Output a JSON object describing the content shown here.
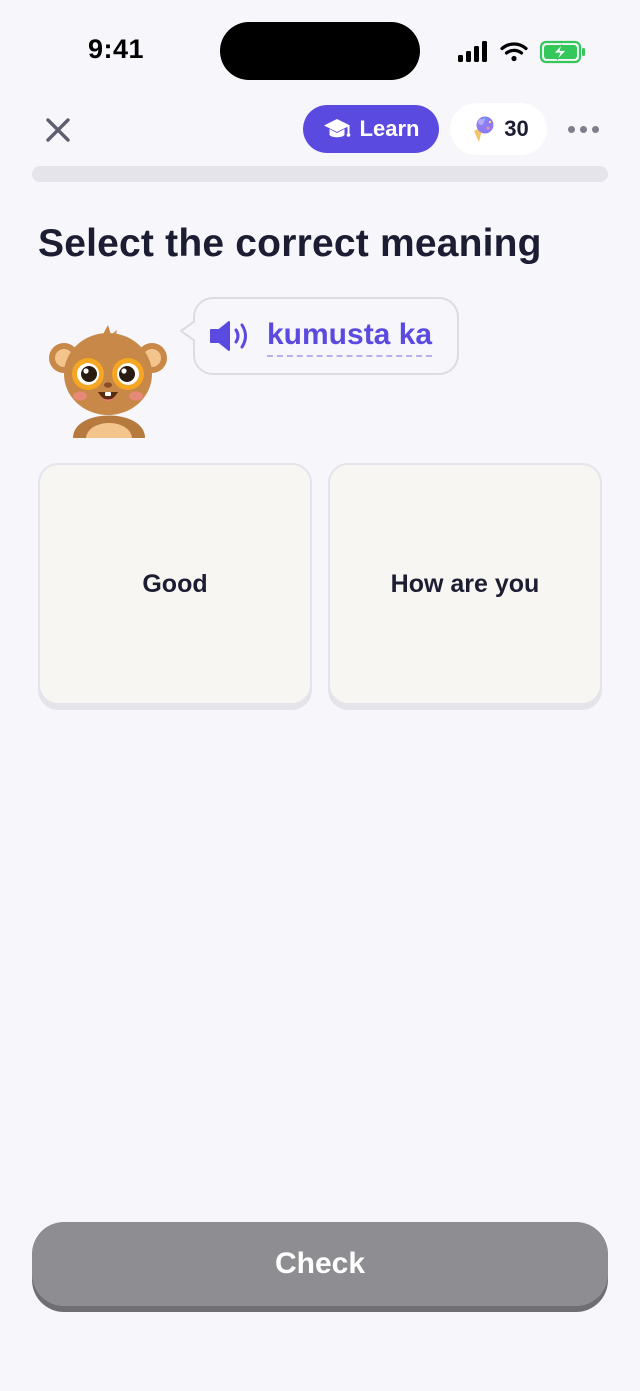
{
  "status_bar": {
    "time": "9:41"
  },
  "top_bar": {
    "learn_label": "Learn",
    "gems_count": "30"
  },
  "progress": {
    "fraction": 0.0
  },
  "prompt": {
    "title": "Select the correct meaning",
    "phrase": "kumusta ka"
  },
  "options": [
    {
      "label": "Good"
    },
    {
      "label": "How are you"
    }
  ],
  "footer": {
    "check_label": "Check"
  },
  "colors": {
    "accent": "#5b4adf",
    "background": "#f6f6fb",
    "card": "#f7f6f3",
    "check_disabled": "#8e8e92",
    "battery": "#34c759"
  },
  "icons": {
    "close": "close-icon",
    "learn": "graduation-cap-icon",
    "gems": "ice-cream-icon",
    "more": "more-horizontal-icon",
    "speaker": "speaker-icon",
    "signal": "cellular-signal-icon",
    "wifi": "wifi-icon",
    "battery": "battery-charging-icon"
  }
}
